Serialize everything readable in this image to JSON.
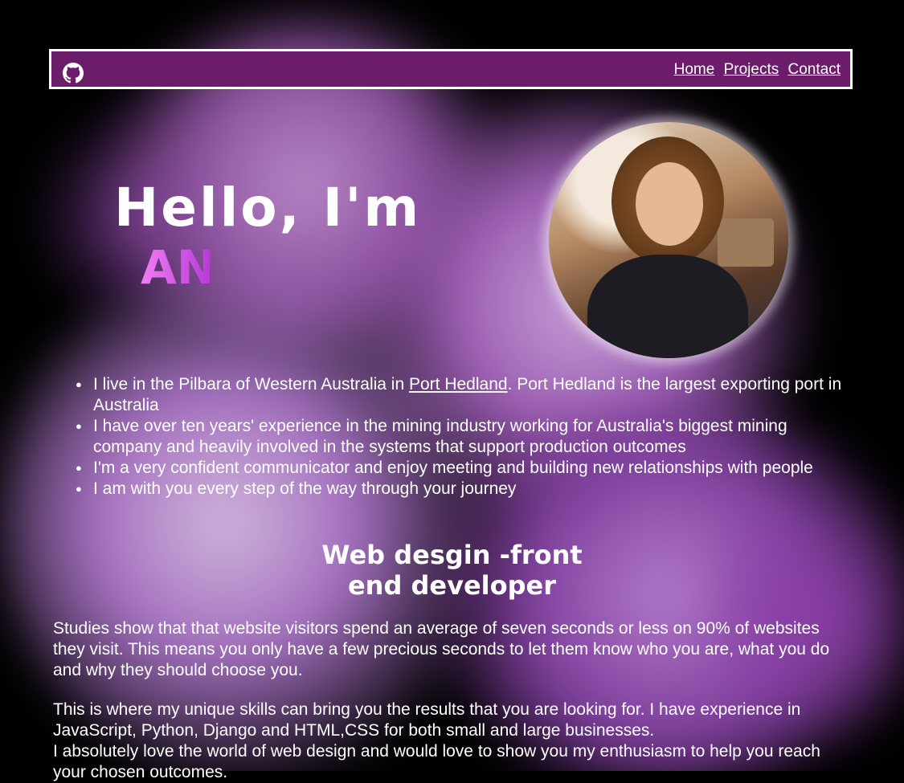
{
  "nav": {
    "github_icon": "github-icon",
    "links": [
      "Home",
      "Projects",
      "Contact"
    ]
  },
  "hero": {
    "greeting": "Hello, I'm",
    "name_visible": "AN"
  },
  "facts": [
    {
      "before": "I live in the Pilbara of Western Australia in ",
      "link": "Port Hedland",
      "after": ". Port Hedland is the largest exporting port in Australia"
    },
    {
      "before": "I have over ten years' experience in the mining industry working for Australia's biggest mining company and heavily involved in the systems that support production outcomes"
    },
    {
      "before": "I'm a very confident communicator and enjoy meeting and building new relationships with people"
    },
    {
      "before": "I am with you every step of the way through your journey"
    }
  ],
  "section": {
    "heading": "Web desgin -front end developer",
    "paragraph1": "Studies show that that website visitors spend an average of seven seconds or less on 90% of websites they visit. This means you only have a few precious seconds to let them know who you are, what you do and why they should choose you.",
    "paragraph2_line1": "This is where my unique skills can bring you the results that you are looking for. I have experience in JavaScript, Python, Django and HTML,CSS for both small and large businesses.",
    "paragraph2_line2": "I absolutely love the world of web design and would love to show you my enthusiasm to help you reach your chosen outcomes."
  },
  "colors": {
    "navbar": "#6b1d6b",
    "name_gradient_start": "#f07df2",
    "name_gradient_end": "#b83bd9"
  }
}
